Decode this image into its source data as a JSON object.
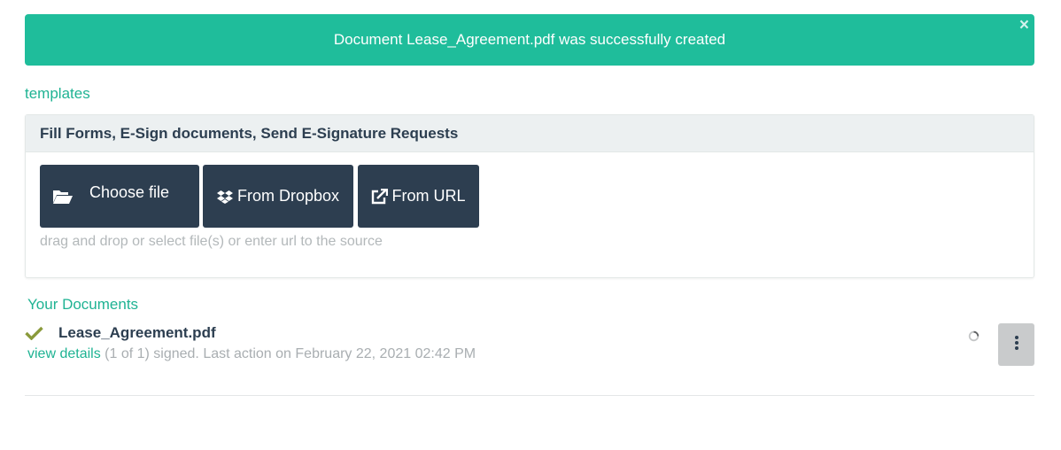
{
  "alert": {
    "message": "Document Lease_Agreement.pdf was successfully created",
    "close_label": "×"
  },
  "templates_link": "templates",
  "upload_panel": {
    "heading": "Fill Forms, E-Sign documents, Send E-Signature Requests",
    "choose_file_label": "Choose file",
    "dropbox_label": "From Dropbox",
    "url_label": "From URL",
    "hint": "drag and drop or select file(s) or enter url to the source"
  },
  "documents": {
    "title": "Your Documents",
    "items": [
      {
        "name": "Lease_Agreement.pdf",
        "view_details": "view details",
        "status": " (1 of 1) signed. Last action on February 22, 2021 02:42 PM",
        "status_icon": "check-icon"
      }
    ]
  },
  "colors": {
    "accent": "#1fbd9b",
    "button_dark": "#2d3e50",
    "check": "#8a9a3b"
  }
}
